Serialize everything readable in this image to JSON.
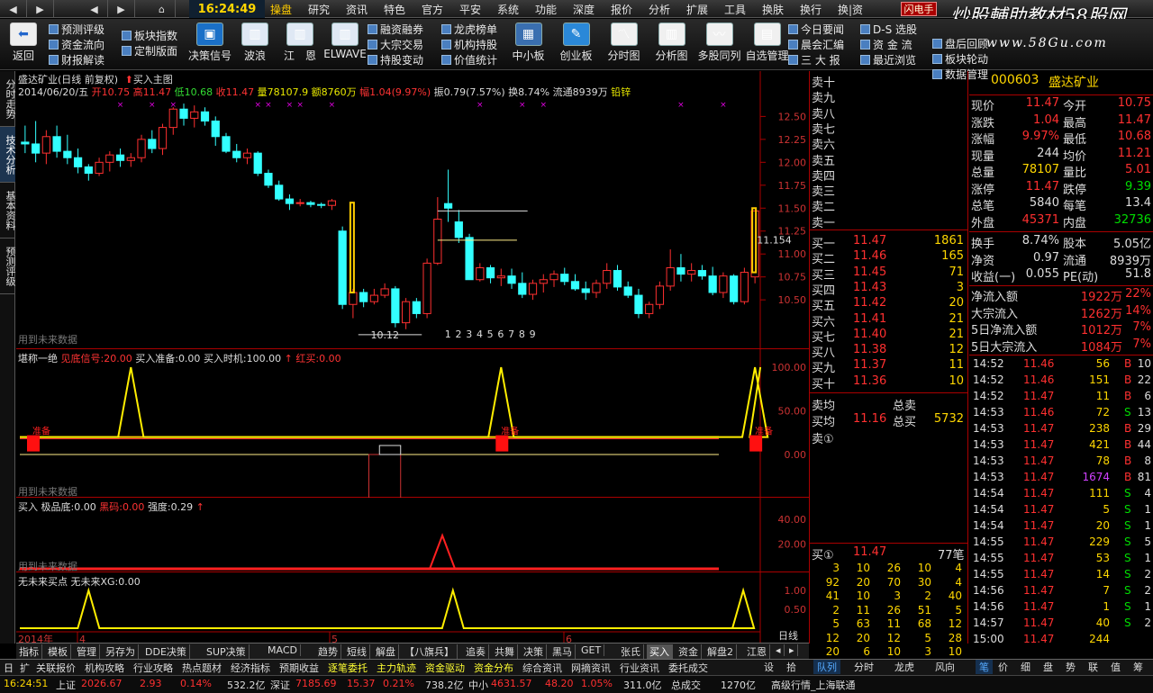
{
  "menubar": {
    "nav": [
      "◀",
      "▶",
      "◀",
      "▶",
      "⌂"
    ],
    "clock": "16:24:49",
    "items": [
      "操盘",
      "研究",
      "资讯",
      "特色",
      "官方",
      "平安",
      "系统",
      "功能",
      "深度",
      "报价",
      "分析",
      "扩展",
      "工具",
      "换肤",
      "换行",
      "换|资"
    ],
    "active_index": 0,
    "brand_tag": "闪电手"
  },
  "watermark": {
    "title": "炒股輔助教材58股网",
    "url": "www.58Gu.com"
  },
  "toolbar": {
    "back_label": "返回",
    "small_col1": [
      "预测评级",
      "资金流向",
      "财报解读"
    ],
    "small_col2": [
      "板块指数",
      "定制版面"
    ],
    "big_buttons": [
      "决策信号",
      "波浪",
      "江　恩",
      "ELWAVE"
    ],
    "small_col3": [
      "融资融券",
      "大宗交易",
      "持股变动"
    ],
    "small_col4": [
      "龙虎榜单",
      "机构持股",
      "价值统计"
    ],
    "big_buttons2": [
      "中小板",
      "创业板",
      "分时图",
      "分析图",
      "多股同列",
      "自选管理"
    ],
    "small_col5": [
      "今日要闻",
      "晨会汇编",
      "三 大 报"
    ],
    "small_col6": [
      "D-S 选股",
      "资 金 流",
      "最近浏览"
    ],
    "small_col7": [
      "盘后回顾",
      "板块轮动",
      "数据管理"
    ]
  },
  "left_tabs": [
    "分时走势",
    "技术分析",
    "基本资料",
    "预测评级"
  ],
  "left_tab_active": 1,
  "kline_pane": {
    "title": "盛达矿业(日线 前复权)",
    "buy_main": "买入主图",
    "date": "2014/06/20/五",
    "open_label": "开",
    "open": "10.75",
    "high_label": "高",
    "high": "11.47",
    "low_label": "低",
    "low": "10.68",
    "close_label": "收",
    "close": "11.47",
    "vol_label": "量",
    "vol": "78107.9",
    "amt_label": "额",
    "amt": "8760万",
    "chg_label": "幅",
    "chg": "1.04(9.97%)",
    "amp_label": "振",
    "amp": "0.79(7.57%)",
    "turn_label": "换",
    "turn": "8.74%",
    "float_label": "流通",
    "float": "8939万",
    "sector": "铅锌",
    "future_note": "用到未来数据",
    "annot_high": "11.154",
    "annot_low": "10.12",
    "wave_counts": [
      "1",
      "2",
      "3",
      "4",
      "5",
      "6",
      "7",
      "8",
      "9"
    ],
    "yaxis": [
      "12.50",
      "12.25",
      "12.00",
      "11.75",
      "11.50",
      "11.25",
      "11.00",
      "10.75",
      "10.50"
    ]
  },
  "ind1": {
    "name": "堪称一绝",
    "k1": "见底信号:",
    "v1": "20.00",
    "k2": "买入准备:",
    "v2": "0.00",
    "k3": "买入时机:",
    "v3": "100.00",
    "k4": "红买:",
    "v4": "0.00",
    "tags": [
      "准备",
      "准备",
      "准备"
    ],
    "yaxis": [
      "100.00",
      "50.00",
      "0.00"
    ],
    "future_note": "用到未来数据"
  },
  "ind2": {
    "name": "买入",
    "k1": "极品底:",
    "v1": "0.00",
    "k2": "黑码:",
    "v2": "0.00",
    "k3": "强度:",
    "v3": "0.29",
    "yaxis": [
      "40.00",
      "20.00"
    ],
    "future_note": "用到未来数据"
  },
  "ind3": {
    "name": "无未来买点",
    "k1": "无未来XG:",
    "v1": "0.00",
    "yaxis": [
      "1.00",
      "0.50"
    ],
    "xaxis": [
      "2014年",
      "4",
      "5",
      "6"
    ],
    "period": "日线"
  },
  "chart_data": {
    "type": "candlestick",
    "ohlc": [
      [
        12.22,
        12.4,
        12.1,
        12.2
      ],
      [
        12.2,
        12.45,
        12.0,
        12.1
      ],
      [
        12.1,
        12.35,
        11.98,
        12.28
      ],
      [
        12.28,
        12.4,
        12.05,
        12.12
      ],
      [
        12.12,
        12.3,
        11.98,
        12.05
      ],
      [
        12.05,
        12.15,
        11.88,
        11.95
      ],
      [
        11.95,
        11.98,
        11.8,
        11.88
      ],
      [
        11.88,
        12.05,
        11.85,
        12.0
      ],
      [
        12.0,
        12.12,
        11.9,
        12.08
      ],
      [
        12.08,
        12.15,
        11.95,
        12.02
      ],
      [
        12.02,
        12.1,
        11.95,
        12.05
      ],
      [
        12.05,
        12.3,
        12.0,
        12.25
      ],
      [
        12.25,
        12.35,
        12.1,
        12.15
      ],
      [
        12.15,
        12.42,
        12.08,
        12.38
      ],
      [
        12.38,
        12.6,
        12.3,
        12.58
      ],
      [
        12.58,
        12.64,
        12.4,
        12.48
      ],
      [
        12.48,
        12.62,
        12.38,
        12.55
      ],
      [
        12.55,
        12.6,
        12.4,
        12.45
      ],
      [
        12.45,
        12.5,
        12.18,
        12.28
      ],
      [
        12.28,
        12.32,
        12.1,
        12.12
      ],
      [
        12.12,
        12.2,
        12.0,
        12.05
      ],
      [
        12.05,
        12.15,
        11.98,
        12.1
      ],
      [
        12.1,
        12.12,
        11.85,
        11.88
      ],
      [
        11.88,
        11.92,
        11.72,
        11.75
      ],
      [
        11.75,
        11.8,
        11.58,
        11.6
      ],
      [
        11.6,
        11.65,
        11.48,
        11.55
      ],
      [
        11.55,
        11.6,
        11.52,
        11.56
      ],
      [
        11.56,
        11.58,
        11.51,
        11.54
      ],
      [
        11.54,
        11.56,
        11.5,
        11.53
      ],
      [
        11.53,
        11.6,
        11.48,
        11.58
      ],
      [
        11.25,
        11.3,
        10.4,
        10.45
      ],
      [
        10.45,
        10.62,
        10.3,
        10.58
      ],
      [
        10.58,
        10.62,
        10.42,
        10.48
      ],
      [
        10.48,
        10.62,
        10.45,
        10.55
      ],
      [
        10.55,
        10.68,
        10.52,
        10.62
      ],
      [
        10.62,
        10.65,
        10.2,
        10.25
      ],
      [
        10.25,
        10.52,
        10.18,
        10.48
      ],
      [
        10.48,
        10.52,
        10.3,
        10.35
      ],
      [
        10.35,
        10.95,
        10.3,
        10.9
      ],
      [
        10.9,
        11.62,
        10.88,
        11.38
      ],
      [
        11.55,
        11.92,
        11.35,
        11.5
      ],
      [
        11.35,
        11.48,
        11.12,
        11.18
      ],
      [
        11.18,
        11.22,
        10.72,
        10.72
      ],
      [
        10.72,
        10.9,
        10.7,
        10.85
      ],
      [
        10.85,
        10.88,
        10.68,
        10.74
      ],
      [
        10.74,
        10.84,
        10.65,
        10.76
      ],
      [
        10.76,
        10.84,
        10.62,
        10.68
      ],
      [
        10.68,
        10.8,
        10.52,
        10.56
      ],
      [
        10.56,
        10.72,
        10.5,
        10.68
      ],
      [
        10.68,
        10.78,
        10.58,
        10.72
      ],
      [
        10.72,
        10.82,
        10.64,
        10.78
      ],
      [
        10.78,
        10.85,
        10.66,
        10.7
      ],
      [
        10.7,
        10.78,
        10.6,
        10.62
      ],
      [
        10.62,
        10.7,
        10.5,
        10.58
      ],
      [
        10.58,
        10.72,
        10.52,
        10.68
      ],
      [
        10.68,
        10.9,
        10.62,
        10.82
      ],
      [
        10.82,
        10.88,
        10.6,
        10.64
      ],
      [
        10.64,
        10.7,
        10.52,
        10.55
      ],
      [
        10.55,
        10.62,
        10.3,
        10.35
      ],
      [
        10.35,
        10.48,
        10.3,
        10.45
      ],
      [
        10.45,
        10.7,
        10.4,
        10.65
      ],
      [
        10.65,
        11.05,
        10.6,
        10.85
      ],
      [
        10.85,
        11.0,
        10.7,
        10.78
      ],
      [
        10.78,
        10.9,
        10.7,
        10.82
      ],
      [
        10.82,
        10.88,
        10.72,
        10.76
      ],
      [
        10.76,
        10.86,
        10.55,
        10.58
      ],
      [
        10.58,
        10.8,
        10.52,
        10.76
      ],
      [
        10.76,
        10.78,
        10.45,
        10.48
      ],
      [
        10.48,
        10.85,
        10.45,
        10.8
      ],
      [
        10.75,
        11.47,
        10.68,
        11.47
      ]
    ],
    "ind1_signals": [
      10,
      45,
      69
    ],
    "ind2_spike": 42,
    "ind3_spikes": [
      6,
      42,
      73
    ],
    "ylim": [
      10.05,
      12.7
    ]
  },
  "bottom_tabs": [
    "指标",
    "模板",
    "管理",
    "另存为",
    "DDE决策",
    "SUP决策",
    "MACD",
    "趋势",
    "短线",
    "解盘",
    "【八旗兵】",
    "追奏",
    "共舞",
    "决策",
    "黑马",
    "GET",
    "张氏",
    "买入",
    "资金",
    "解盘2",
    "江恩"
  ],
  "bottom_tab_active": 17,
  "statusbar1": [
    "日",
    "扩",
    "关联报价",
    "机构攻略",
    "行业攻略",
    "热点题材",
    "经济指标",
    "预期收益",
    "逐笔委托",
    "主力轨迹",
    "资金驱动",
    "资金分布",
    "综合资讯",
    "网摘资讯",
    "行业资讯",
    "委托成交"
  ],
  "statusbar1_hl": [
    8,
    9,
    10,
    11
  ],
  "right_bottom_tabs": [
    "设",
    "拾",
    "队列",
    "分时",
    "龙虎",
    "风向",
    "笔",
    "价",
    "细",
    "盘",
    "势",
    "联",
    "值",
    "筹"
  ],
  "statusbar2": {
    "time": "16:24:51",
    "sh_label": "上证",
    "sh": "2026.67",
    "sh_chg": "2.93",
    "sh_pct": "0.14%",
    "sh_amt": "532.2亿",
    "sz_label": "深证",
    "sz": "7185.69",
    "sz_chg": "15.37",
    "sz_pct": "0.21%",
    "sz_amt": "738.2亿",
    "zx_label": "中小",
    "zx": "4631.57",
    "zx_chg": "48.20",
    "zx_pct": "1.05%",
    "zx_amt": "311.0亿",
    "total_label": "总成交",
    "total": "1270亿",
    "feed": "高级行情_上海联通"
  },
  "orderbook": {
    "sell": [
      [
        "卖十",
        "",
        ""
      ],
      [
        "卖九",
        "",
        ""
      ],
      [
        "卖八",
        "",
        ""
      ],
      [
        "卖七",
        "",
        ""
      ],
      [
        "卖六",
        "",
        ""
      ],
      [
        "卖五",
        "",
        ""
      ],
      [
        "卖四",
        "",
        ""
      ],
      [
        "卖三",
        "",
        ""
      ],
      [
        "卖二",
        "",
        ""
      ],
      [
        "卖一",
        "",
        ""
      ]
    ],
    "buy": [
      [
        "买一",
        "11.47",
        "1861"
      ],
      [
        "买二",
        "11.46",
        "165"
      ],
      [
        "买三",
        "11.45",
        "71"
      ],
      [
        "买四",
        "11.43",
        "3"
      ],
      [
        "买五",
        "11.42",
        "20"
      ],
      [
        "买六",
        "11.41",
        "21"
      ],
      [
        "买七",
        "11.40",
        "21"
      ],
      [
        "买八",
        "11.38",
        "12"
      ],
      [
        "买九",
        "11.37",
        "11"
      ],
      [
        "买十",
        "11.36",
        "10"
      ]
    ],
    "avg_sell_label": "卖均",
    "total_sell_label": "总卖",
    "avg_buy_label": "买均",
    "avg_buy": "11.16",
    "total_buy_label": "总买",
    "total_buy": "5732",
    "sell1_queue_label": "卖①",
    "buy1_queue_label": "买①",
    "buy1_queue_px": "11.47",
    "buy1_queue_count": "77笔",
    "queue": [
      [
        "3",
        "10",
        "26",
        "10",
        "4"
      ],
      [
        "92",
        "20",
        "70",
        "30",
        "4"
      ],
      [
        "41",
        "10",
        "3",
        "2",
        "40"
      ],
      [
        "2",
        "11",
        "26",
        "51",
        "5"
      ],
      [
        "5",
        "63",
        "11",
        "68",
        "12"
      ],
      [
        "12",
        "20",
        "12",
        "5",
        "28"
      ],
      [
        "20",
        "6",
        "10",
        "3",
        "10"
      ]
    ]
  },
  "quote": {
    "code": "000603",
    "name": "盛达矿业",
    "rows": [
      [
        "现价",
        "11.47",
        "red",
        "今开",
        "10.75",
        "red"
      ],
      [
        "涨跌",
        "1.04",
        "red",
        "最高",
        "11.47",
        "red"
      ],
      [
        "涨幅",
        "9.97%",
        "red",
        "最低",
        "10.68",
        "red"
      ],
      [
        "现量",
        "244",
        "white",
        "均价",
        "11.21",
        "red"
      ],
      [
        "总量",
        "78107",
        "yellow",
        "量比",
        "5.01",
        "red"
      ],
      [
        "涨停",
        "11.47",
        "red",
        "跌停",
        "9.39",
        "green"
      ],
      [
        "总笔",
        "5840",
        "white",
        "每笔",
        "13.4",
        "white"
      ],
      [
        "外盘",
        "45371",
        "red",
        "内盘",
        "32736",
        "green"
      ]
    ],
    "rows2": [
      [
        "换手",
        "8.74%",
        "股本",
        "5.05亿"
      ],
      [
        "净资",
        "0.97",
        "流通",
        "8939万"
      ],
      [
        "收益(一)",
        "0.055",
        "PE(动)",
        "51.8"
      ]
    ],
    "flows": [
      [
        "净流入额",
        "1922万",
        "22%"
      ],
      [
        "大宗流入",
        "1262万",
        "14%"
      ],
      [
        "5日净流入额",
        "1012万",
        "7%"
      ],
      [
        "5日大宗流入",
        "1084万",
        "7%"
      ]
    ],
    "ticks": [
      [
        "14:52",
        "11.46",
        "56",
        "B",
        "10"
      ],
      [
        "14:52",
        "11.46",
        "151",
        "B",
        "22"
      ],
      [
        "14:52",
        "11.47",
        "11",
        "B",
        "6"
      ],
      [
        "14:53",
        "11.46",
        "72",
        "S",
        "13"
      ],
      [
        "14:53",
        "11.47",
        "238",
        "B",
        "29"
      ],
      [
        "14:53",
        "11.47",
        "421",
        "B",
        "44"
      ],
      [
        "14:53",
        "11.47",
        "78",
        "B",
        "8"
      ],
      [
        "14:53",
        "11.47",
        "1674",
        "B",
        "81"
      ],
      [
        "14:54",
        "11.47",
        "111",
        "S",
        "4"
      ],
      [
        "14:54",
        "11.47",
        "5",
        "S",
        "1"
      ],
      [
        "14:54",
        "11.47",
        "20",
        "S",
        "1"
      ],
      [
        "14:55",
        "11.47",
        "229",
        "S",
        "5"
      ],
      [
        "14:55",
        "11.47",
        "53",
        "S",
        "1"
      ],
      [
        "14:55",
        "11.47",
        "14",
        "S",
        "2"
      ],
      [
        "14:56",
        "11.47",
        "7",
        "S",
        "2"
      ],
      [
        "14:56",
        "11.47",
        "1",
        "S",
        "1"
      ],
      [
        "14:57",
        "11.47",
        "40",
        "S",
        "2"
      ],
      [
        "15:00",
        "11.47",
        "244",
        "",
        ""
      ]
    ]
  }
}
